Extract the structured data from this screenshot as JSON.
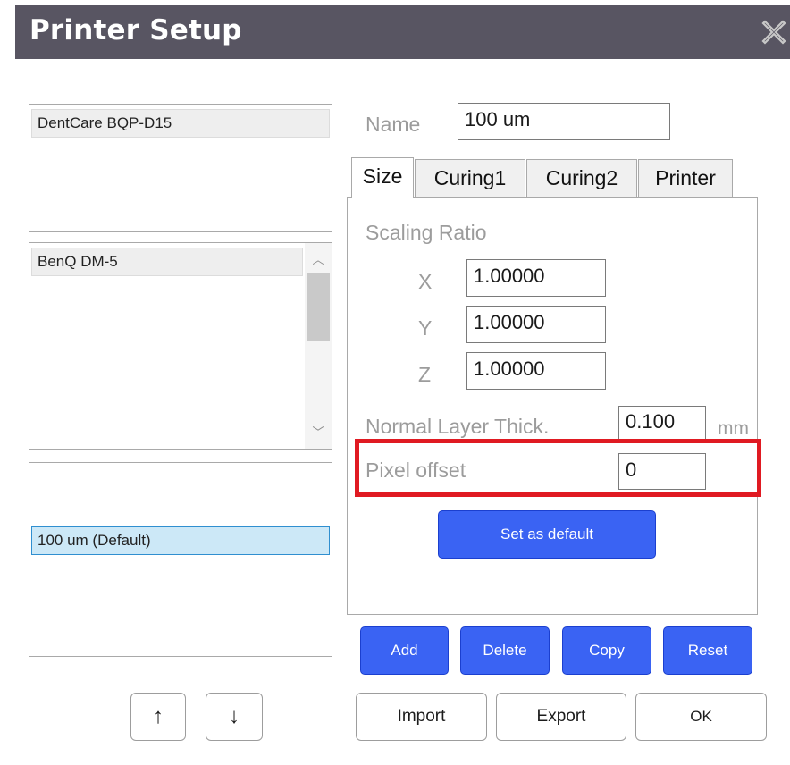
{
  "window": {
    "title": "Printer Setup"
  },
  "lists": {
    "manufacturer": {
      "items": [
        "DentCare BQP-D15"
      ]
    },
    "model": {
      "items": [
        "BenQ DM-5"
      ]
    },
    "profile": {
      "items": [
        "100 um (Default)"
      ]
    }
  },
  "move_buttons": {
    "up": "↑",
    "down": "↓"
  },
  "name": {
    "label": "Name",
    "value": "100 um"
  },
  "tabs": [
    {
      "label": "Size",
      "active": true
    },
    {
      "label": "Curing1",
      "active": false
    },
    {
      "label": "Curing2",
      "active": false
    },
    {
      "label": "Printer",
      "active": false
    }
  ],
  "size_tab": {
    "scaling_label": "Scaling Ratio",
    "x_label": "X",
    "x_value": "1.00000",
    "y_label": "Y",
    "y_value": "1.00000",
    "z_label": "Z",
    "z_value": "1.00000",
    "layer_label": "Normal Layer Thick.",
    "layer_value": "0.100",
    "layer_unit": "mm",
    "pixel_label": "Pixel offset",
    "pixel_value": "0",
    "set_default": "Set as default"
  },
  "actions": {
    "add": "Add",
    "delete": "Delete",
    "copy": "Copy",
    "reset": "Reset"
  },
  "footer": {
    "import": "Import",
    "export": "Export",
    "ok": "OK"
  },
  "colors": {
    "titlebar": "#585562",
    "accent_blue": "#3a63f3",
    "highlight_red": "#e01a22",
    "selection": "#cce8f7"
  }
}
